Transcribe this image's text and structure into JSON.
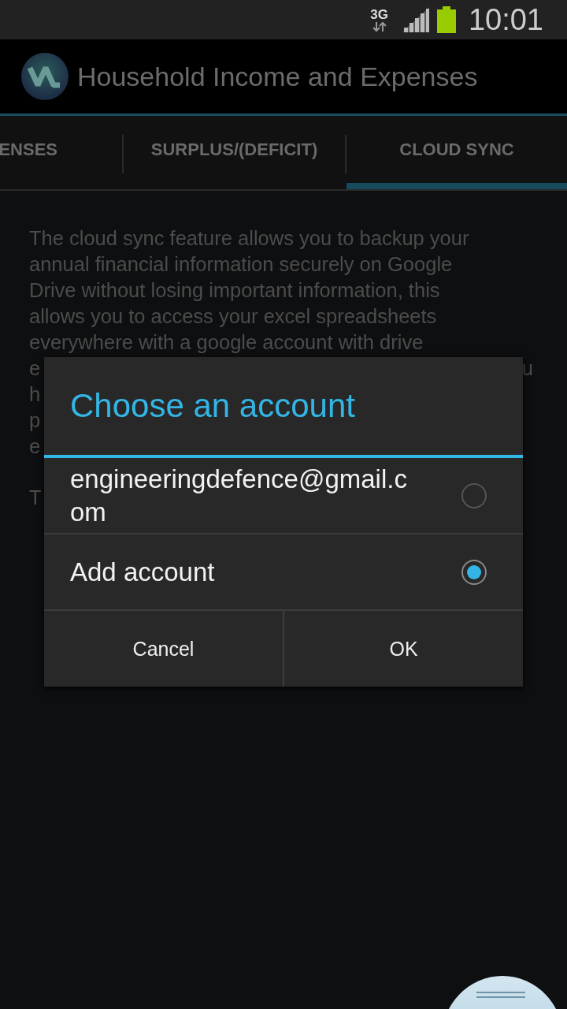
{
  "status_bar": {
    "network": "3G",
    "time": "10:01"
  },
  "action_bar": {
    "title": "Household Income and Expenses"
  },
  "tabs": [
    {
      "label": "ENSES",
      "selected": false
    },
    {
      "label": "SURPLUS/(DEFICIT)",
      "selected": false
    },
    {
      "label": "CLOUD SYNC",
      "selected": true
    }
  ],
  "content": {
    "paragraph_lines": [
      "The cloud sync feature allows you to backup your",
      "annual financial information securely on Google",
      "Drive without losing important information, this",
      "allows you to access your excel spreadsheets",
      "everywhere with a google account with drive"
    ],
    "partial_lines": [
      {
        "left": "e",
        "right": "u"
      },
      {
        "left": "h"
      },
      {
        "left": "p"
      },
      {
        "left": "e"
      }
    ],
    "partial_label": "T"
  },
  "dialog": {
    "title": "Choose an account",
    "options": [
      {
        "label": "engineeringdefence@gmail.com",
        "selected": false
      },
      {
        "label": "Add account",
        "selected": true
      }
    ],
    "buttons": [
      "Cancel",
      "OK"
    ]
  }
}
